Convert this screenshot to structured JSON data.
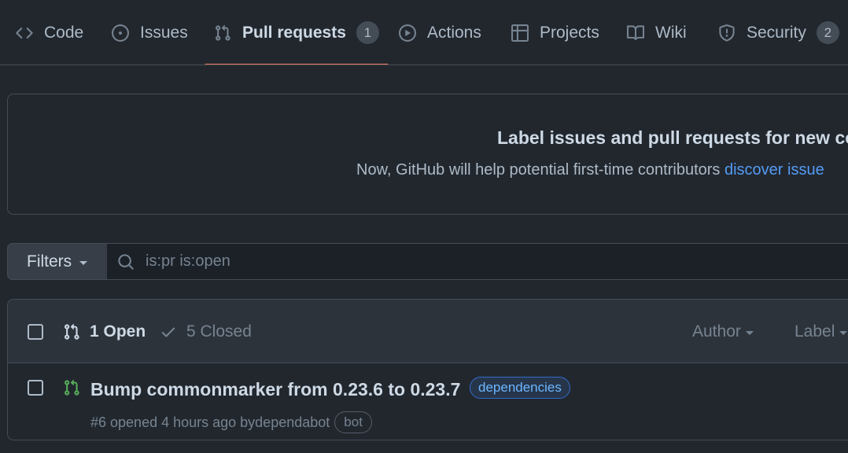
{
  "tabs": [
    {
      "label": "Code",
      "icon": "code-icon"
    },
    {
      "label": "Issues",
      "icon": "issue-opened-icon"
    },
    {
      "label": "Pull requests",
      "icon": "git-pull-request-icon",
      "count": "1",
      "selected": true
    },
    {
      "label": "Actions",
      "icon": "play-icon"
    },
    {
      "label": "Projects",
      "icon": "table-icon"
    },
    {
      "label": "Wiki",
      "icon": "book-icon"
    },
    {
      "label": "Security",
      "icon": "shield-icon",
      "count": "2"
    }
  ],
  "banner": {
    "title": "Label issues and pull requests for new con",
    "text": "Now, GitHub will help potential first-time contributors ",
    "link": "discover issue"
  },
  "filters": {
    "button_label": "Filters",
    "search_value": "is:pr is:open"
  },
  "list": {
    "open_label": "1 Open",
    "closed_label": "5 Closed",
    "author_label": "Author",
    "label_label": "Label",
    "rows": [
      {
        "title": "Bump commonmarker from 0.23.6 to 0.23.7",
        "label": "dependencies",
        "meta": "#6 opened 4 hours ago by ",
        "author": "dependabot",
        "author_badge": "bot"
      }
    ]
  },
  "colors": {
    "background": "#22272e",
    "selected_tab_underline": "#ec775c",
    "open_pr_green": "#57ab5a",
    "link_blue": "#539bf5"
  }
}
